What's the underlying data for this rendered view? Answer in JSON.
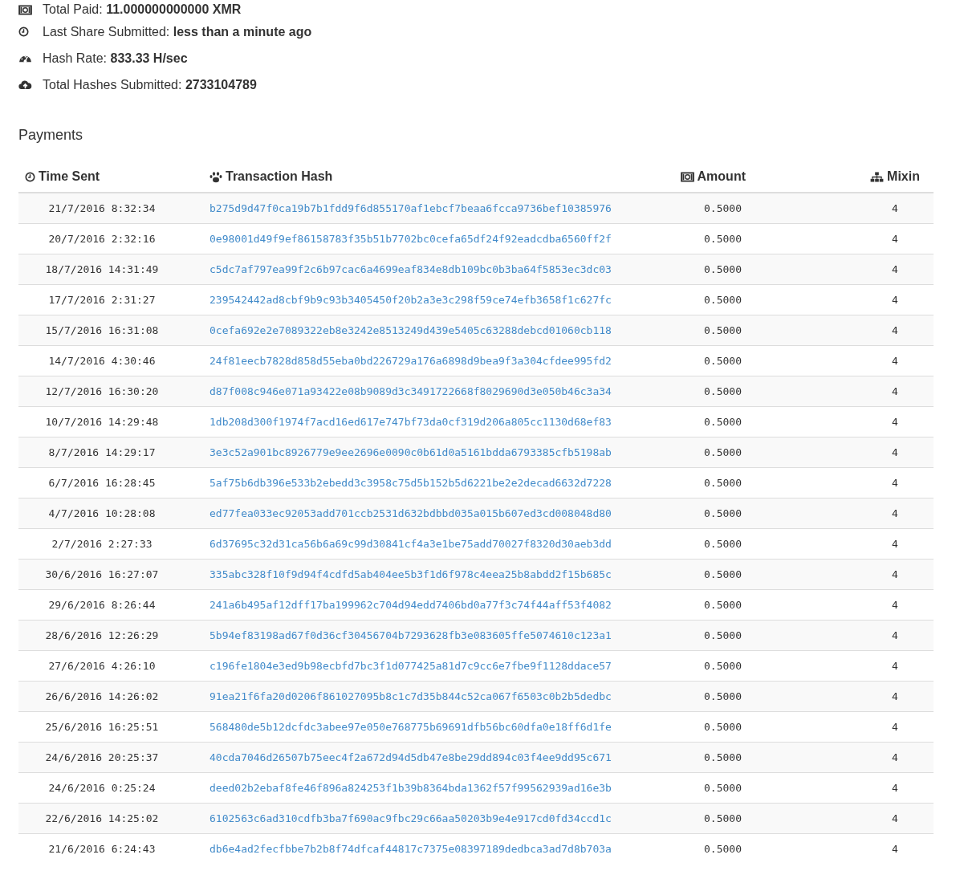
{
  "stats": [
    {
      "kind": "money",
      "text": "Total Paid: **11.000000000000 XMR**"
    },
    {
      "kind": "clock",
      "text": "Last Share Submitted: **less than a minute ago**"
    },
    {
      "kind": "gauge",
      "text": "Hash Rate: **833.33 H/sec**"
    },
    {
      "kind": "cloud",
      "text": "Total Hashes Submitted: **2733104789**"
    }
  ],
  "payments": {
    "title": "Payments",
    "columns": [
      {
        "kind": "clock",
        "label": "Time Sent"
      },
      {
        "kind": "paw",
        "label": "Transaction Hash"
      },
      {
        "kind": "money",
        "label": "Amount"
      },
      {
        "kind": "sitemap",
        "label": "Mixin"
      }
    ],
    "rows": [
      {
        "time": "21/7/2016 8:32:34",
        "hash": "b275d9d47f0ca19b7b1fdd9f6d855170af1ebcf7beaa6fcca9736bef10385976",
        "amount": "0.5000",
        "mixin": "4"
      },
      {
        "time": "20/7/2016 2:32:16",
        "hash": "0e98001d49f9ef86158783f35b51b7702bc0cefa65df24f92eadcdba6560ff2f",
        "amount": "0.5000",
        "mixin": "4"
      },
      {
        "time": "18/7/2016 14:31:49",
        "hash": "c5dc7af797ea99f2c6b97cac6a4699eaf834e8db109bc0b3ba64f5853ec3dc03",
        "amount": "0.5000",
        "mixin": "4"
      },
      {
        "time": "17/7/2016 2:31:27",
        "hash": "239542442ad8cbf9b9c93b3405450f20b2a3e3c298f59ce74efb3658f1c627fc",
        "amount": "0.5000",
        "mixin": "4"
      },
      {
        "time": "15/7/2016 16:31:08",
        "hash": "0cefa692e2e7089322eb8e3242e8513249d439e5405c63288debcd01060cb118",
        "amount": "0.5000",
        "mixin": "4"
      },
      {
        "time": "14/7/2016 4:30:46",
        "hash": "24f81eecb7828d858d55eba0bd226729a176a6898d9bea9f3a304cfdee995fd2",
        "amount": "0.5000",
        "mixin": "4"
      },
      {
        "time": "12/7/2016 16:30:20",
        "hash": "d87f008c946e071a93422e08b9089d3c3491722668f8029690d3e050b46c3a34",
        "amount": "0.5000",
        "mixin": "4"
      },
      {
        "time": "10/7/2016 14:29:48",
        "hash": "1db208d300f1974f7acd16ed617e747bf73da0cf319d206a805cc1130d68ef83",
        "amount": "0.5000",
        "mixin": "4"
      },
      {
        "time": "8/7/2016 14:29:17",
        "hash": "3e3c52a901bc8926779e9ee2696e0090c0b61d0a5161bdda6793385cfb5198ab",
        "amount": "0.5000",
        "mixin": "4"
      },
      {
        "time": "6/7/2016 16:28:45",
        "hash": "5af75b6db396e533b2ebedd3c3958c75d5b152b5d6221be2e2decad6632d7228",
        "amount": "0.5000",
        "mixin": "4"
      },
      {
        "time": "4/7/2016 10:28:08",
        "hash": "ed77fea033ec92053add701ccb2531d632bdbbd035a015b607ed3cd008048d80",
        "amount": "0.5000",
        "mixin": "4"
      },
      {
        "time": "2/7/2016 2:27:33",
        "hash": "6d37695c32d31ca56b6a69c99d30841cf4a3e1be75add70027f8320d30aeb3dd",
        "amount": "0.5000",
        "mixin": "4"
      },
      {
        "time": "30/6/2016 16:27:07",
        "hash": "335abc328f10f9d94f4cdfd5ab404ee5b3f1d6f978c4eea25b8abdd2f15b685c",
        "amount": "0.5000",
        "mixin": "4"
      },
      {
        "time": "29/6/2016 8:26:44",
        "hash": "241a6b495af12dff17ba199962c704d94edd7406bd0a77f3c74f44aff53f4082",
        "amount": "0.5000",
        "mixin": "4"
      },
      {
        "time": "28/6/2016 12:26:29",
        "hash": "5b94ef83198ad67f0d36cf30456704b7293628fb3e083605ffe5074610c123a1",
        "amount": "0.5000",
        "mixin": "4"
      },
      {
        "time": "27/6/2016 4:26:10",
        "hash": "c196fe1804e3ed9b98ecbfd7bc3f1d077425a81d7c9cc6e7fbe9f1128ddace57",
        "amount": "0.5000",
        "mixin": "4"
      },
      {
        "time": "26/6/2016 14:26:02",
        "hash": "91ea21f6fa20d0206f861027095b8c1c7d35b844c52ca067f6503c0b2b5dedbc",
        "amount": "0.5000",
        "mixin": "4"
      },
      {
        "time": "25/6/2016 16:25:51",
        "hash": "568480de5b12dcfdc3abee97e050e768775b69691dfb56bc60dfa0e18ff6d1fe",
        "amount": "0.5000",
        "mixin": "4"
      },
      {
        "time": "24/6/2016 20:25:37",
        "hash": "40cda7046d26507b75eec4f2a672d94d5db47e8be29dd894c03f4ee9dd95c671",
        "amount": "0.5000",
        "mixin": "4"
      },
      {
        "time": "24/6/2016 0:25:24",
        "hash": "deed02b2ebaf8fe46f896a824253f1b39b8364bda1362f57f99562939ad16e3b",
        "amount": "0.5000",
        "mixin": "4"
      },
      {
        "time": "22/6/2016 14:25:02",
        "hash": "6102563c6ad310cdfb3ba7f690ac9fbc29c66aa50203b9e4e917cd0fd34ccd1c",
        "amount": "0.5000",
        "mixin": "4"
      },
      {
        "time": "21/6/2016 6:24:43",
        "hash": "db6e4ad2fecfbbe7b2b8f74dfcaf44817c7375e08397189dedbca3ad7d8b703a",
        "amount": "0.5000",
        "mixin": "4"
      }
    ]
  }
}
